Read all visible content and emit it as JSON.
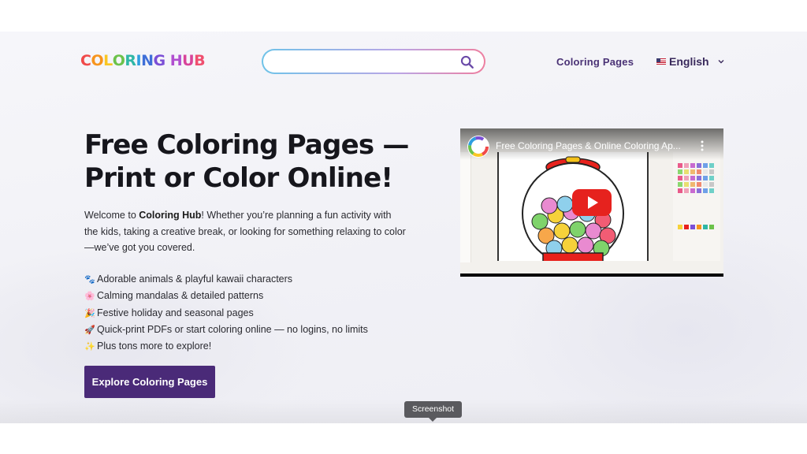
{
  "header": {
    "logo_letters": [
      {
        "ch": "C",
        "color": "#f04a4a"
      },
      {
        "ch": "O",
        "color": "#f7941d"
      },
      {
        "ch": "L",
        "color": "#f9c623"
      },
      {
        "ch": "O",
        "color": "#6cc24a"
      },
      {
        "ch": "R",
        "color": "#2fb7a6"
      },
      {
        "ch": "I",
        "color": "#2f9fe0"
      },
      {
        "ch": "N",
        "color": "#3f6fd8"
      },
      {
        "ch": "G",
        "color": "#7b4fd6"
      },
      {
        "ch": " ",
        "color": "#000000"
      },
      {
        "ch": "H",
        "color": "#b14fd0"
      },
      {
        "ch": "U",
        "color": "#d8449a"
      },
      {
        "ch": "B",
        "color": "#ef4f6f"
      }
    ],
    "search": {
      "placeholder": "",
      "value": "",
      "icon": "search-icon"
    },
    "nav_link": "Coloring Pages",
    "language": {
      "label": "English",
      "flag": "us-flag-icon",
      "icon": "chevron-down-icon"
    }
  },
  "hero": {
    "title_line1": "Free Coloring Pages —",
    "title_line2": "Print or Color Online!",
    "intro_before": "Welcome to ",
    "intro_brand": "Coloring Hub",
    "intro_after": "! Whether you’re planning a fun activity with the kids, taking a creative break, or looking for something relaxing to color—we’ve got you covered.",
    "features": [
      {
        "emoji": "🐾",
        "text": "Adorable animals & playful kawaii characters"
      },
      {
        "emoji": "🌸",
        "text": "Calming mandalas & detailed patterns"
      },
      {
        "emoji": "🎉",
        "text": "Festive holiday and seasonal pages"
      },
      {
        "emoji": "🚀",
        "text": "Quick-print PDFs or start coloring online — no logins, no limits"
      },
      {
        "emoji": "✨",
        "text": "Plus tons more to explore!"
      }
    ],
    "cta_label": "Explore Coloring Pages"
  },
  "video": {
    "title": "Free Coloring Pages & Online Coloring Ap...",
    "play_icon": "youtube-play-icon"
  },
  "tooltip": "Screenshot",
  "colors": {
    "brand_purple": "#4a2a78",
    "nav_text": "#4a3275",
    "youtube_red": "#e6221e"
  }
}
